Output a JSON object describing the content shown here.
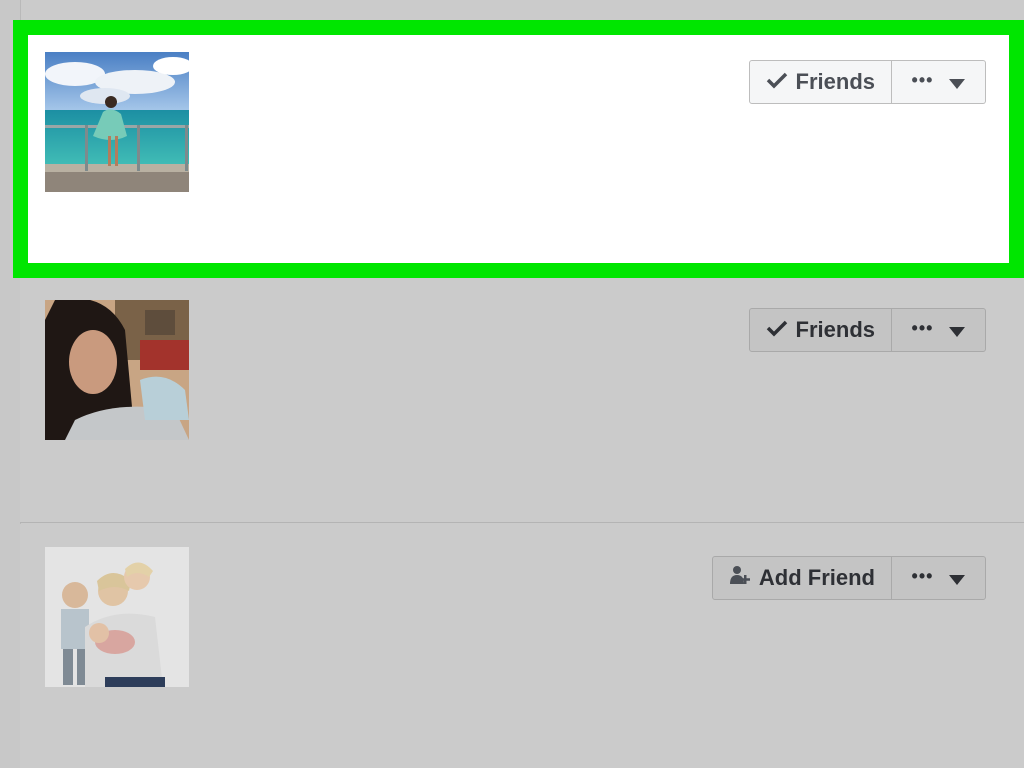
{
  "colors": {
    "highlight": "#00e600",
    "active_row_bg": "#ffffff",
    "dimmed_row_bg": "#cbcbcb",
    "button_text": "#4b4f56"
  },
  "rows": [
    {
      "status_label": "Friends",
      "status_icon": "checkmark-icon",
      "avatar": "beach-photo-avatar",
      "more_icon": "ellipsis-icon",
      "dropdown_icon": "caret-down-icon",
      "highlighted": true
    },
    {
      "status_label": "Friends",
      "status_icon": "checkmark-icon",
      "avatar": "selfie-avatar",
      "more_icon": "ellipsis-icon",
      "dropdown_icon": "caret-down-icon",
      "highlighted": false
    },
    {
      "status_label": "Add Friend",
      "status_icon": "add-friend-icon",
      "avatar": "family-photo-avatar",
      "more_icon": "ellipsis-icon",
      "dropdown_icon": "caret-down-icon",
      "highlighted": false
    }
  ],
  "more_dots": "•••"
}
